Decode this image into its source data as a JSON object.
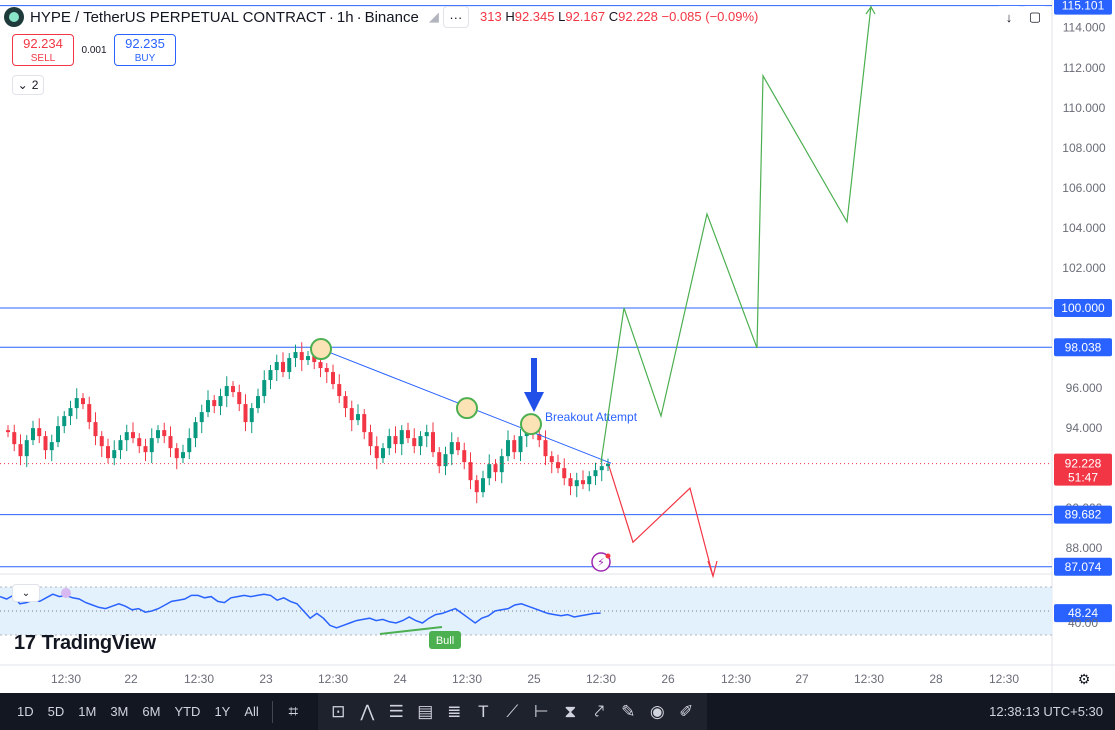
{
  "header": {
    "symbol": "HYPE / TetherUS PERPETUAL CONTRACT",
    "interval": "1h",
    "exchange": "Binance",
    "ohlc": {
      "o_suffix": "313",
      "h_label": "H",
      "h": "92.345",
      "l_label": "L",
      "l": "92.167",
      "c_label": "C",
      "c": "92.228",
      "change": "−0.085 (−0.09%)"
    }
  },
  "trade": {
    "sell_price": "92.234",
    "sell_label": "SELL",
    "spread": "0.001",
    "buy_price": "92.235",
    "buy_label": "BUY"
  },
  "layers": {
    "count": "2"
  },
  "chart_data": {
    "type": "candlestick",
    "title": "HYPE / TetherUS PERPETUAL CONTRACT · 1h · Binance",
    "ylim": [
      86.5,
      115.5
    ],
    "y_ticks": [
      "114.000",
      "112.000",
      "110.000",
      "108.000",
      "106.000",
      "104.000",
      "102.000",
      "100.000",
      "98.000",
      "96.000",
      "94.000",
      "92.000",
      "90.000",
      "88.000"
    ],
    "x_ticks": [
      "12:30",
      "22",
      "12:30",
      "23",
      "12:30",
      "24",
      "12:30",
      "25",
      "12:30",
      "26",
      "12:30",
      "27",
      "12:30",
      "28",
      "12:30"
    ],
    "close_series": [
      93.8,
      93.2,
      92.6,
      93.4,
      94.0,
      93.6,
      92.9,
      93.3,
      94.1,
      94.6,
      95.0,
      95.5,
      95.2,
      94.3,
      93.6,
      93.1,
      92.5,
      92.9,
      93.4,
      93.8,
      93.5,
      93.1,
      92.8,
      93.5,
      93.9,
      93.6,
      93.0,
      92.5,
      92.8,
      93.5,
      94.3,
      94.8,
      95.4,
      95.1,
      95.6,
      96.1,
      95.8,
      95.2,
      94.3,
      95.0,
      95.6,
      96.4,
      96.9,
      97.3,
      96.8,
      97.5,
      97.8,
      97.4,
      97.6,
      97.3,
      97.0,
      96.8,
      96.2,
      95.6,
      95.0,
      94.4,
      94.7,
      93.8,
      93.1,
      92.5,
      93.0,
      93.6,
      93.2,
      93.9,
      93.5,
      93.1,
      93.6,
      93.8,
      92.8,
      92.1,
      92.7,
      93.3,
      92.9,
      92.3,
      91.4,
      90.8,
      91.5,
      92.2,
      91.8,
      92.6,
      93.4,
      92.8,
      93.6,
      94.0,
      93.7,
      93.4,
      92.6,
      92.3,
      92.0,
      91.5,
      91.1,
      91.4,
      91.2,
      91.6,
      91.9,
      92.1,
      92.228
    ],
    "levels": [
      {
        "label": "115.101",
        "value": 115.101
      },
      {
        "label": "100.000",
        "value": 100.0
      },
      {
        "label": "98.038",
        "value": 98.038
      },
      {
        "label": "89.682",
        "value": 89.682
      },
      {
        "label": "87.074",
        "value": 87.074
      }
    ],
    "current_price": {
      "label": "92.228",
      "countdown": "51:47",
      "value": 92.228
    },
    "trendline": {
      "x1": "23 12:30",
      "y1": 97.95,
      "x2": "25 18:00",
      "y2": 92.25
    },
    "touch_points": [
      {
        "x": "23 12:30",
        "y": 97.95
      },
      {
        "x": "24 12:30",
        "y": 95.0
      },
      {
        "x": "25 00:30",
        "y": 94.2
      }
    ],
    "bull_projection": [
      92.3,
      100.0,
      94.6,
      104.7,
      98.0,
      111.6,
      104.3,
      115.101
    ],
    "bear_projection": [
      92.1,
      88.3,
      91.0,
      86.6
    ],
    "annotations": {
      "breakout": "Breakout Attempt",
      "bull_badge": "Bull"
    },
    "rsi": {
      "value_label": "48.24",
      "value": 48.24,
      "lower_tick": "40.00",
      "band": [
        30,
        70
      ],
      "series": [
        62,
        60,
        63,
        56,
        57,
        59,
        58,
        61,
        64,
        62,
        63,
        61,
        60,
        57,
        55,
        53,
        52,
        54,
        56,
        54,
        51,
        52,
        49,
        50,
        52,
        55,
        58,
        59,
        60,
        63,
        63,
        61,
        62,
        58,
        57,
        61,
        62,
        63,
        62,
        63,
        64,
        63,
        59,
        61,
        58,
        56,
        50,
        44,
        48,
        44,
        38,
        36,
        38,
        40,
        42,
        43,
        44,
        42,
        43,
        41,
        40,
        42,
        45,
        42,
        40,
        44,
        47,
        48,
        50,
        52,
        48,
        44,
        40,
        44,
        46,
        50,
        51,
        52,
        55,
        56,
        54,
        52,
        50,
        48,
        47,
        46,
        47,
        45,
        46,
        47,
        48,
        48.24
      ]
    }
  },
  "watermark": "TradingView",
  "bottom": {
    "timeframes": [
      "1D",
      "5D",
      "1M",
      "3M",
      "6M",
      "YTD",
      "1Y",
      "All"
    ],
    "clock": "12:38:13 UTC+5:30"
  },
  "colors": {
    "up": "#089981",
    "down": "#f23645",
    "level": "#2962ff",
    "bull": "#4caf50",
    "bear": "#f23645"
  }
}
